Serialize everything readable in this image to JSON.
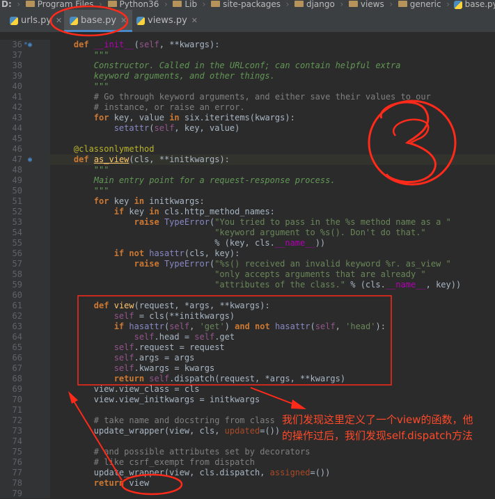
{
  "breadcrumbs": [
    "D:",
    "Program Files",
    "Python36",
    "Lib",
    "site-packages",
    "django",
    "views",
    "generic",
    "base.py"
  ],
  "tabs": [
    {
      "label": "urls.py",
      "active": false
    },
    {
      "label": "base.py",
      "active": true
    },
    {
      "label": "views.py",
      "active": false
    }
  ],
  "annotation_mark": "③",
  "annotation_text": [
    "我们发现这里定义了一个view的函数，他",
    "的操作过后，我们发现self.dispatch方法"
  ],
  "colors": {
    "keyword": "#cc7832",
    "string": "#6a8759",
    "comment": "#808080",
    "annotation": "#ff2a1a"
  },
  "code_lines": [
    {
      "n": "36",
      "html": "    <span class=\"kw\">def</span> <span class=\"mg\">__init__</span>(<span class=\"sf\">self</span>, **kwargs):"
    },
    {
      "n": "37",
      "html": "        <span class=\"ds\">\"\"\"</span>"
    },
    {
      "n": "38",
      "html": "        <span class=\"ds\">Constructor. Called in the URLconf; can contain helpful extra</span>"
    },
    {
      "n": "39",
      "html": "        <span class=\"ds\">keyword arguments, and other things.</span>"
    },
    {
      "n": "40",
      "html": "        <span class=\"ds\">\"\"\"</span>"
    },
    {
      "n": "41",
      "html": "        <span class=\"cm\"># Go through keyword arguments, and either save their values to our</span>"
    },
    {
      "n": "42",
      "html": "        <span class=\"cm\"># instance, or raise an error.</span>"
    },
    {
      "n": "43",
      "html": "        <span class=\"kw\">for</span> key, value <span class=\"kw\">in</span> six.iteritems(kwargs):"
    },
    {
      "n": "44",
      "html": "            <span class=\"bi\">setattr</span>(<span class=\"sf\">self</span>, key, value)"
    },
    {
      "n": "45",
      "html": ""
    },
    {
      "n": "46",
      "html": "    <span class=\"dc\">@classonlymethod</span>"
    },
    {
      "n": "47",
      "html": "    <span class=\"kw\">def</span> <span class=\"fn\" style=\"text-decoration:underline\">as_view</span>(cls, **initkwargs):"
    },
    {
      "n": "48",
      "html": "        <span class=\"ds\">\"\"\"</span>"
    },
    {
      "n": "49",
      "html": "        <span class=\"ds\">Main entry point for a request-response process.</span>"
    },
    {
      "n": "50",
      "html": "        <span class=\"ds\">\"\"\"</span>"
    },
    {
      "n": "51",
      "html": "        <span class=\"kw\">for</span> key <span class=\"kw\">in</span> initkwargs:"
    },
    {
      "n": "52",
      "html": "            <span class=\"kw\">if</span> key <span class=\"kw\">in</span> cls.http_method_names:"
    },
    {
      "n": "53",
      "html": "                <span class=\"kw\">raise</span> <span class=\"bi\">TypeError</span>(<span class=\"st\">\"You tried to pass in the %s method name as a \"</span>"
    },
    {
      "n": "54",
      "html": "                                <span class=\"st\">\"keyword argument to %s(). Don't do that.\"</span>"
    },
    {
      "n": "55",
      "html": "                                % (key, cls.<span class=\"mg\">__name__</span>))"
    },
    {
      "n": "56",
      "html": "            <span class=\"kw\">if not</span> <span class=\"bi\">hasattr</span>(cls, key):"
    },
    {
      "n": "57",
      "html": "                <span class=\"kw\">raise</span> <span class=\"bi\">TypeError</span>(<span class=\"st\">\"%s() received an invalid keyword %r. as_view \"</span>"
    },
    {
      "n": "58",
      "html": "                                <span class=\"st\">\"only accepts arguments that are already \"</span>"
    },
    {
      "n": "59",
      "html": "                                <span class=\"st\">\"attributes of the class.\"</span> % (cls.<span class=\"mg\">__name__</span>, key))"
    },
    {
      "n": "60",
      "html": ""
    },
    {
      "n": "61",
      "html": "        <span class=\"kw\">def</span> <span class=\"fn\">view</span>(request, *args, **kwargs):"
    },
    {
      "n": "62",
      "html": "            <span class=\"sf\">self</span> = cls(**initkwargs)"
    },
    {
      "n": "63",
      "html": "            <span class=\"kw\">if</span> <span class=\"bi\">hasattr</span>(<span class=\"sf\">self</span>, <span class=\"st\">'get'</span>) <span class=\"kw\">and not</span> <span class=\"bi\">hasattr</span>(<span class=\"sf\">self</span>, <span class=\"st\">'head'</span>):"
    },
    {
      "n": "64",
      "html": "                <span class=\"sf\">self</span>.head = <span class=\"sf\">self</span>.get"
    },
    {
      "n": "65",
      "html": "            <span class=\"sf\">self</span>.request = request"
    },
    {
      "n": "66",
      "html": "            <span class=\"sf\">self</span>.args = args"
    },
    {
      "n": "67",
      "html": "            <span class=\"sf\">self</span>.kwargs = kwargs"
    },
    {
      "n": "68",
      "html": "            <span class=\"kw\">return</span> <span class=\"sf\">self</span>.dispatch(request, *args, **kwargs)"
    },
    {
      "n": "69",
      "html": "        view.view_class = cls"
    },
    {
      "n": "70",
      "html": "        view.view_initkwargs = initkwargs"
    },
    {
      "n": "71",
      "html": ""
    },
    {
      "n": "72",
      "html": "        <span class=\"cm\"># take name and docstring from class</span>"
    },
    {
      "n": "73",
      "html": "        update_wrapper(view, cls, <span class=\"pr\">updated</span>=())"
    },
    {
      "n": "74",
      "html": ""
    },
    {
      "n": "75",
      "html": "        <span class=\"cm\"># and possible attributes set by decorators</span>"
    },
    {
      "n": "76",
      "html": "        <span class=\"cm\"># like csrf_exempt from dispatch</span>"
    },
    {
      "n": "77",
      "html": "        update_wrapper(view, cls.dispatch, <span class=\"pr\">assigned</span>=())"
    },
    {
      "n": "78",
      "html": "        <span class=\"kw\">return</span> view"
    },
    {
      "n": "79",
      "html": ""
    }
  ]
}
